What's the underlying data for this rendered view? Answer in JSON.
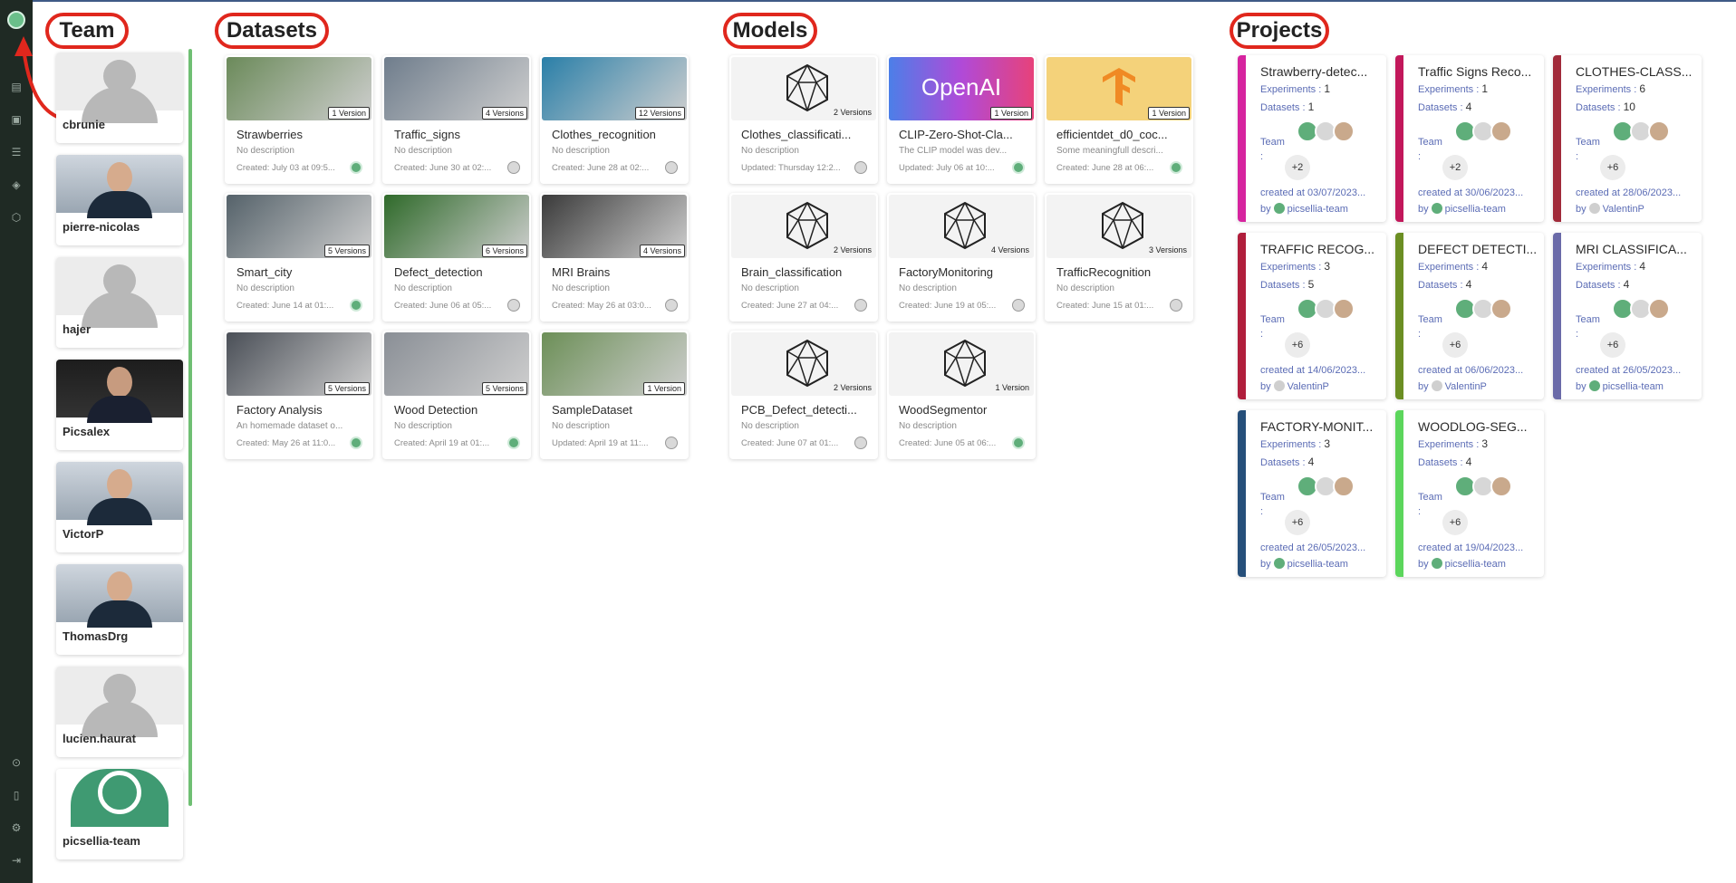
{
  "headers": {
    "team": "Team",
    "datasets": "Datasets",
    "models": "Models",
    "projects": "Projects"
  },
  "team": [
    {
      "name": "cbrunie",
      "photo": "silhouette"
    },
    {
      "name": "pierre-nicolas",
      "photo": "photo"
    },
    {
      "name": "hajer",
      "photo": "silhouette"
    },
    {
      "name": "Picsalex",
      "photo": "photo-dark"
    },
    {
      "name": "VictorP",
      "photo": "photo"
    },
    {
      "name": "ThomasDrg",
      "photo": "photo"
    },
    {
      "name": "lucien.haurat",
      "photo": "silhouette"
    },
    {
      "name": "picsellia-team",
      "photo": "logo"
    }
  ],
  "datasets": [
    {
      "title": "Strawberries",
      "versions": "1 Version",
      "desc": "No description",
      "created": "Created: July 03 at 09:5...",
      "thumb_color": "#6b8a5a"
    },
    {
      "title": "Traffic_signs",
      "versions": "4 Versions",
      "desc": "No description",
      "created": "Created: June 30 at 02:...",
      "thumb_color": "#6f7d8c"
    },
    {
      "title": "Clothes_recognition",
      "versions": "12 Versions",
      "desc": "No description",
      "created": "Created: June 28 at 02:...",
      "thumb_color": "#2a7fa8"
    },
    {
      "title": "Smart_city",
      "versions": "5 Versions",
      "desc": "No description",
      "created": "Created: June 14 at 01:...",
      "thumb_color": "#55626a"
    },
    {
      "title": "Defect_detection",
      "versions": "6 Versions",
      "desc": "No description",
      "created": "Created: June 06 at 05:...",
      "thumb_color": "#2f6a2a"
    },
    {
      "title": "MRI Brains",
      "versions": "4 Versions",
      "desc": "No description",
      "created": "Created: May 26 at 03:0...",
      "thumb_color": "#3a3a3a"
    },
    {
      "title": "Factory Analysis",
      "versions": "5 Versions",
      "desc": "An homemade dataset o...",
      "created": "Created: May 26 at 11:0...",
      "thumb_color": "#4a4f57"
    },
    {
      "title": "Wood Detection",
      "versions": "5 Versions",
      "desc": "No description",
      "created": "Created: April 19 at 01:...",
      "thumb_color": "#8a8f96"
    },
    {
      "title": "SampleDataset",
      "versions": "1 Version",
      "desc": "No description",
      "created": "Updated: April 19 at 11:...",
      "thumb_color": "#6c8f57"
    }
  ],
  "models": [
    {
      "title": "Clothes_classificati...",
      "versions": "2 Versions",
      "desc": "No description",
      "created": "Updated: Thursday 12:2...",
      "kind": "poly"
    },
    {
      "title": "CLIP-Zero-Shot-Cla...",
      "versions": "1 Version",
      "desc": "The CLIP model was dev...",
      "created": "Updated: July 06 at 10:...",
      "kind": "openai",
      "logo_text": "OpenAI"
    },
    {
      "title": "efficientdet_d0_coc...",
      "versions": "1 Version",
      "desc": "Some meaningfull descri...",
      "created": "Created: June 28 at 06:...",
      "kind": "tf"
    },
    {
      "title": "Brain_classification",
      "versions": "2 Versions",
      "desc": "No description",
      "created": "Created: June 27 at 04:...",
      "kind": "poly"
    },
    {
      "title": "FactoryMonitoring",
      "versions": "4 Versions",
      "desc": "No description",
      "created": "Created: June 19 at 05:...",
      "kind": "poly"
    },
    {
      "title": "TrafficRecognition",
      "versions": "3 Versions",
      "desc": "No description",
      "created": "Created: June 15 at 01:...",
      "kind": "poly"
    },
    {
      "title": "PCB_Defect_detecti...",
      "versions": "2 Versions",
      "desc": "No description",
      "created": "Created: June 07 at 01:...",
      "kind": "poly"
    },
    {
      "title": "WoodSegmentor",
      "versions": "1 Version",
      "desc": "No description",
      "created": "Created: June 05 at 06:...",
      "kind": "poly"
    }
  ],
  "projects": [
    {
      "title": "Strawberry-detec...",
      "experiments": "1",
      "datasets": "1",
      "more": "+2",
      "created": "created at 03/07/2023...",
      "by": "picsellia-team",
      "stripe": "#d6249f"
    },
    {
      "title": "Traffic Signs Reco...",
      "experiments": "1",
      "datasets": "4",
      "more": "+2",
      "created": "created at 30/06/2023...",
      "by": "picsellia-team",
      "stripe": "#c2185b"
    },
    {
      "title": "CLOTHES-CLASS...",
      "experiments": "6",
      "datasets": "10",
      "more": "+6",
      "created": "created at 28/06/2023...",
      "by": "ValentinP",
      "stripe": "#a12a3a"
    },
    {
      "title": "TRAFFIC RECOG...",
      "experiments": "3",
      "datasets": "5",
      "more": "+6",
      "created": "created at 14/06/2023...",
      "by": "ValentinP",
      "stripe": "#b01e3c"
    },
    {
      "title": "DEFECT DETECTI...",
      "experiments": "4",
      "datasets": "4",
      "more": "+6",
      "created": "created at 06/06/2023...",
      "by": "ValentinP",
      "stripe": "#6b8e23"
    },
    {
      "title": "MRI CLASSIFICA...",
      "experiments": "4",
      "datasets": "4",
      "more": "+6",
      "created": "created at 26/05/2023...",
      "by": "picsellia-team",
      "stripe": "#6a6aa8"
    },
    {
      "title": "FACTORY-MONIT...",
      "experiments": "3",
      "datasets": "4",
      "more": "+6",
      "created": "created at 26/05/2023...",
      "by": "picsellia-team",
      "stripe": "#264f7a"
    },
    {
      "title": "WOODLOG-SEG...",
      "experiments": "3",
      "datasets": "4",
      "more": "+6",
      "created": "created at 19/04/2023...",
      "by": "picsellia-team",
      "stripe": "#5cd65c"
    }
  ],
  "labels": {
    "experiments": "Experiments : ",
    "datasets": "Datasets : ",
    "team": "Team",
    "colon": ":",
    "by": "by"
  }
}
